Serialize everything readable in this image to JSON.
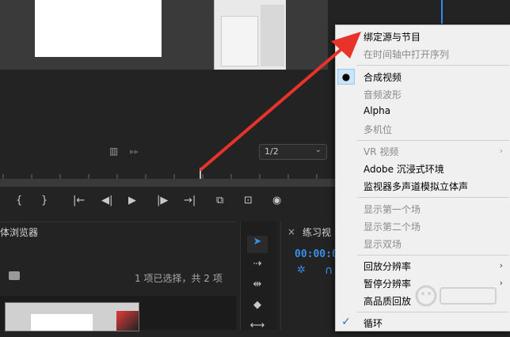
{
  "monitor": {
    "fit_value": "1/2"
  },
  "transport": {
    "buttons": [
      "{",
      "}",
      "|←",
      "◀|",
      "▶",
      "|▶",
      "→|"
    ]
  },
  "project_panel": {
    "title": "体浏览器",
    "selection_info": "1 项已选择，共 2 项"
  },
  "timeline_panel": {
    "title": "练习视",
    "timecode": "00:00:0"
  },
  "context_menu": {
    "items": [
      {
        "label": "绑定源与节目",
        "enabled": true
      },
      {
        "label": "在时间轴中打开序列",
        "enabled": false
      },
      {
        "label": "合成视频",
        "enabled": true,
        "checked": "dot"
      },
      {
        "label": "音频波形",
        "enabled": false
      },
      {
        "label": "Alpha",
        "enabled": true
      },
      {
        "label": "多机位",
        "enabled": false
      },
      {
        "label": "VR 视频",
        "enabled": false,
        "submenu": true
      },
      {
        "label": "Adobe 沉浸式环境",
        "enabled": true
      },
      {
        "label": "监视器多声道模拟立体声",
        "enabled": true
      },
      {
        "label": "显示第一个场",
        "enabled": false
      },
      {
        "label": "显示第二个场",
        "enabled": false
      },
      {
        "label": "显示双场",
        "enabled": false
      },
      {
        "label": "回放分辨率",
        "enabled": true,
        "submenu": true
      },
      {
        "label": "暂停分辨率",
        "enabled": true,
        "submenu": true
      },
      {
        "label": "高品质回放",
        "enabled": true
      },
      {
        "label": "循环",
        "enabled": true,
        "checked": "check"
      }
    ]
  },
  "colors": {
    "accent_blue": "#3b8fe8",
    "annotation_red": "#e8332a",
    "menu_bg": "#f0f0f0"
  }
}
